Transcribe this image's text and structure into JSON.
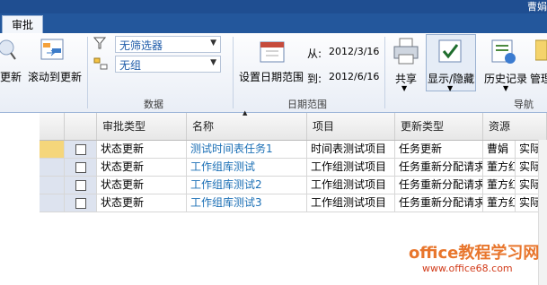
{
  "titlebar": {
    "user": "曹娟"
  },
  "tabs": [
    {
      "label": "审批"
    }
  ],
  "ribbon": {
    "update_label": "更新",
    "scroll_label": "滚动到更新",
    "filter_value": "无筛选器",
    "group_value": "无组",
    "data_group_label": "数据",
    "set_date_range_label": "设置日期范围",
    "from_label": "从:",
    "from_date": "2012/3/16",
    "to_label": "到:",
    "to_date": "2012/6/16",
    "date_range_group_label": "日期范围",
    "share_label": "共享",
    "show_hide_label": "显示/隐藏",
    "history_label": "历史记录",
    "manage_label": "管理",
    "nav_group_label": "导航"
  },
  "table": {
    "columns": [
      "审批类型",
      "名称",
      "项目",
      "更新类型",
      "资源"
    ],
    "rows": [
      {
        "type": "状态更新",
        "name": "测试时间表任务1",
        "project": "时间表测试项目",
        "update_type": "任务更新",
        "resource": "曹娟",
        "extra": "实际"
      },
      {
        "type": "状态更新",
        "name": "工作组库测试",
        "project": "工作组测试项目",
        "update_type": "任务重新分配请求",
        "resource": "董方红",
        "extra": "实际"
      },
      {
        "type": "状态更新",
        "name": "工作组库测试2",
        "project": "工作组测试项目",
        "update_type": "任务重新分配请求",
        "resource": "董方红",
        "extra": "实际"
      },
      {
        "type": "状态更新",
        "name": "工作组库测试3",
        "project": "工作组测试项目",
        "update_type": "任务重新分配请求",
        "resource": "董方红",
        "extra": "实际"
      }
    ]
  },
  "watermark": {
    "line1": "office教程学习网",
    "line2": "www.office68.com"
  }
}
